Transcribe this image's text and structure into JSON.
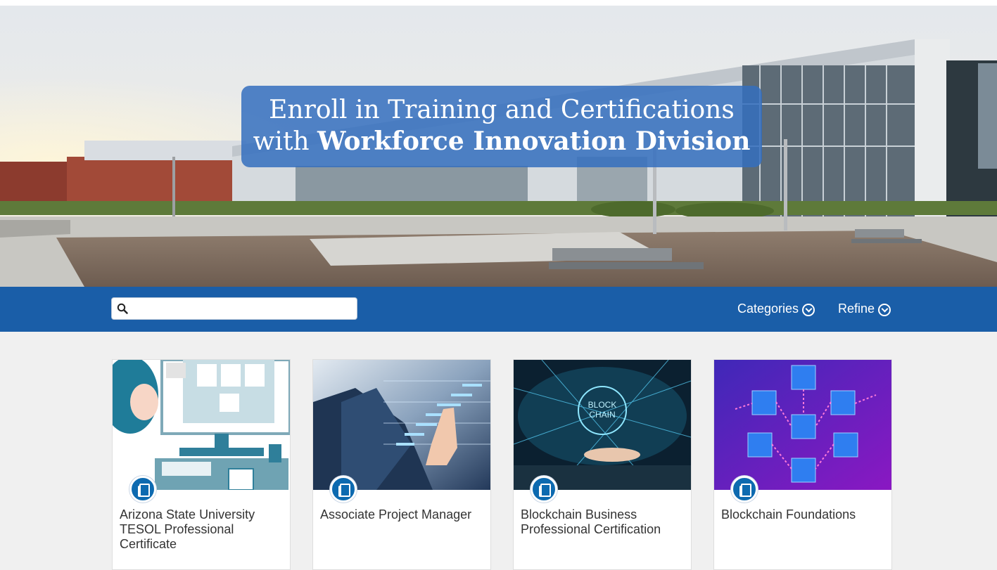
{
  "hero": {
    "line1": "Enroll in Training and Certifications",
    "line2_prefix": "with ",
    "line2_bold": "Workforce Innovation Division"
  },
  "toolbar": {
    "search_placeholder": "",
    "search_value": "",
    "categories_label": "Categories",
    "refine_label": "Refine"
  },
  "cards": [
    {
      "title": "Arizona State University TESOL Professional Certificate",
      "icon": "book-icon"
    },
    {
      "title": "Associate Project Manager",
      "icon": "book-icon"
    },
    {
      "title": "Blockchain Business Professional Certification",
      "icon": "book-icon"
    },
    {
      "title": "Blockchain Foundations",
      "icon": "book-icon"
    }
  ],
  "colors": {
    "toolbar": "#1a5ea8",
    "banner": "#346ebe",
    "badge": "#0d6ab0",
    "page_bg": "#f0f0f0"
  }
}
